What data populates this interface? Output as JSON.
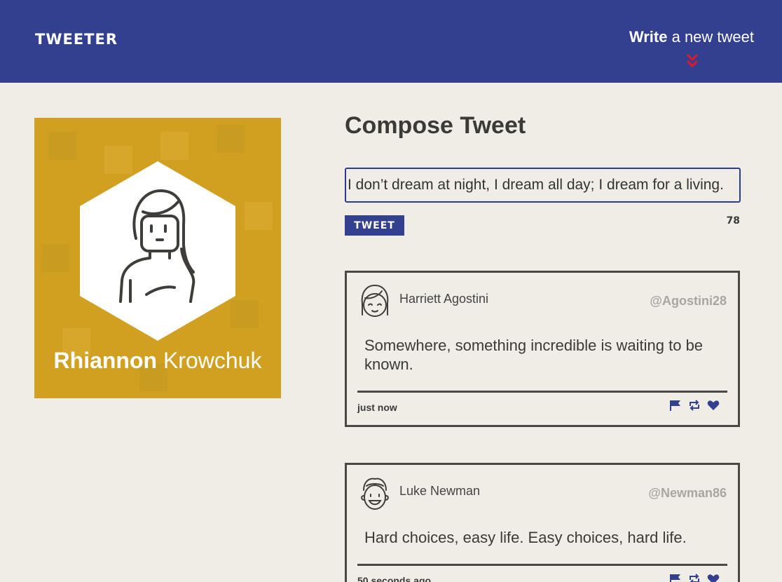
{
  "nav": {
    "brand": "TWEETER",
    "write_bold": "Write",
    "write_rest": "a new tweet"
  },
  "profile": {
    "first_name": "Rhiannon",
    "last_name": "Krowchuk",
    "avatar_icon": "woman-avatar-icon"
  },
  "compose": {
    "title": "Compose Tweet",
    "input_value": "I don’t dream at night, I dream all day; I dream for a living.",
    "button_label": "TWEET",
    "counter": "78"
  },
  "tweets": [
    {
      "name": "Harriett Agostini",
      "handle": "@Agostini28",
      "text": "Somewhere, something incredible is waiting to be known.",
      "time": "just now"
    },
    {
      "name": "Luke Newman",
      "handle": "@Newman86",
      "text": "Hard choices, easy life. Easy choices, hard life.",
      "time": "50 seconds ago"
    }
  ],
  "colors": {
    "nav": "#333f8f",
    "profile_bg": "#d1a021",
    "chevron": "#e0182a",
    "page_bg": "#f0ede6"
  }
}
